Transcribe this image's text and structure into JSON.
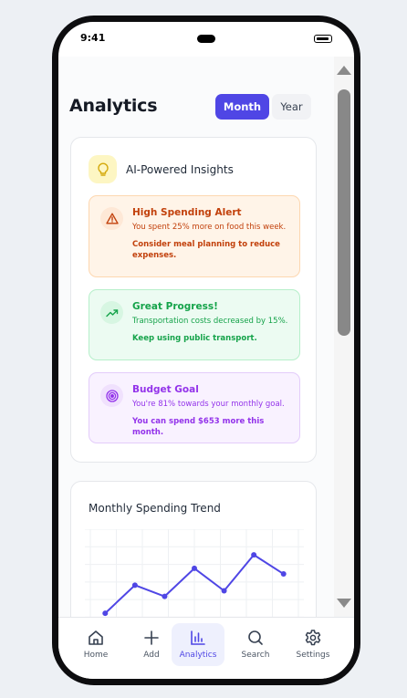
{
  "status": {
    "time": "9:41"
  },
  "header": {
    "title": "Analytics"
  },
  "period_toggle": {
    "month_label": "Month",
    "year_label": "Year",
    "selected": "Month"
  },
  "insights": {
    "title": "AI-Powered Insights",
    "icon": "lightbulb-icon",
    "items": [
      {
        "title": "High Spending Alert",
        "description": "You spent 25% more on food this week.",
        "tip": "Consider meal planning to reduce expenses.",
        "icon": "warning-icon",
        "color": "#c2410c"
      },
      {
        "title": "Great Progress!",
        "description": "Transportation costs decreased by 15%.",
        "tip": "Keep using public transport.",
        "icon": "trending-up-icon",
        "color": "#15a34a"
      },
      {
        "title": "Budget Goal",
        "description": "You're 81% towards your monthly goal.",
        "tip": "You can spend $653 more this month.",
        "icon": "target-icon",
        "color": "#9333ea"
      }
    ]
  },
  "trend": {
    "title": "Monthly Spending Trend"
  },
  "chart_data": {
    "type": "line",
    "title": "Monthly Spending Trend",
    "xlabel": "",
    "ylabel": "",
    "x": [
      1,
      2,
      3,
      4,
      5,
      6,
      7
    ],
    "values": [
      30,
      55,
      45,
      70,
      50,
      82,
      65
    ],
    "ylim": [
      0,
      100
    ],
    "grid": true,
    "color": "#4f46e5"
  },
  "nav": {
    "items": [
      {
        "label": "Home",
        "icon": "home-icon"
      },
      {
        "label": "Add",
        "icon": "plus-icon"
      },
      {
        "label": "Analytics",
        "icon": "bar-chart-icon"
      },
      {
        "label": "Search",
        "icon": "search-icon"
      },
      {
        "label": "Settings",
        "icon": "gear-icon"
      }
    ],
    "active": "Analytics"
  },
  "colors": {
    "accent": "#4f46e5"
  }
}
